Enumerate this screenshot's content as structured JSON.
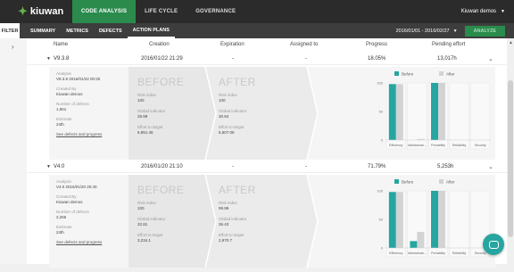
{
  "app": {
    "logo_text": "kiuwan",
    "user": "Kiuwan demos"
  },
  "topnav": [
    {
      "label": "CODE ANALYSIS",
      "active": true
    },
    {
      "label": "LIFE CYCLE",
      "active": false
    },
    {
      "label": "GOVERNANCE",
      "active": false
    }
  ],
  "subnav": {
    "filter_label": "FILTER",
    "tabs": [
      {
        "label": "SUMMARY"
      },
      {
        "label": "METRICS"
      },
      {
        "label": "DEFECTS"
      },
      {
        "label": "ACTION PLANS",
        "active": true
      }
    ],
    "date_range": "2016/01/01 - 2016/02/27",
    "analyze_label": "ANALYZE"
  },
  "table": {
    "columns": {
      "name": "Name",
      "creation": "Creation",
      "expiration": "Expiration",
      "assigned": "Assigned to",
      "progress": "Progress",
      "effort": "Pending effort"
    }
  },
  "plans": [
    {
      "name": "V9.3.8",
      "creation": "2016/01/22 21:29",
      "expiration": "-",
      "assigned": "-",
      "progress": "18.05%",
      "effort": "13,017h",
      "analysis_label": "Analysis",
      "analysis": "V9.3.8 2016/01/22 00:25",
      "created_by_label": "Created By",
      "created_by": "Kiuwan demos",
      "defects_label": "Number of defects",
      "defects": "1,801",
      "estimate_label": "Estimate",
      "estimate": "24th",
      "link": "See defects and progress",
      "before": {
        "title": "BEFORE",
        "risk_label": "Risk index",
        "risk": "100",
        "global_label": "Global indicator",
        "global": "29.98",
        "effort_label": "Effort to target",
        "effort": "6,851.45"
      },
      "after": {
        "title": "AFTER",
        "risk_label": "Risk index",
        "risk": "100",
        "global_label": "Global indicator",
        "global": "30.84",
        "effort_label": "Effort to target",
        "effort": "6,607.05"
      },
      "chart_data": {
        "type": "bar",
        "legend": [
          "Before",
          "After"
        ],
        "categories": [
          "Efficiency",
          "Maintainab...",
          "Portability",
          "Reliability",
          "Security"
        ],
        "series": [
          {
            "name": "Before",
            "values": [
              98,
              0,
              100,
              0,
              0
            ]
          },
          {
            "name": "After",
            "values": [
              98,
              2,
              100,
              0,
              0
            ]
          }
        ],
        "yticks": [
          "0",
          "50",
          "100"
        ],
        "ylim": [
          0,
          100
        ]
      }
    },
    {
      "name": "V4.0",
      "creation": "2016/01/20 21:10",
      "expiration": "-",
      "assigned": "-",
      "progress": "71.79%",
      "effort": "5,253h",
      "analysis_label": "Analysis",
      "analysis": "V4.0 2016/01/20 20:40",
      "created_by_label": "Created By",
      "created_by": "Kiuwan demos",
      "defects_label": "Number of defects",
      "defects": "2,265",
      "estimate_label": "Estimate",
      "estimate": "24th",
      "link": "See defects and progress",
      "before": {
        "title": "BEFORE",
        "risk_label": "Risk index",
        "risk": "100",
        "global_label": "Global indicator",
        "global": "32.81",
        "effort_label": "Effort to target",
        "effort": "3,234.1"
      },
      "after": {
        "title": "AFTER",
        "risk_label": "Risk index",
        "risk": "99.99",
        "global_label": "Global indicator",
        "global": "36.43",
        "effort_label": "Effort to target",
        "effort": "2,970.7"
      },
      "chart_data": {
        "type": "bar",
        "legend": [
          "Before",
          "After"
        ],
        "categories": [
          "Efficiency",
          "Maintainab...",
          "Portability",
          "Reliability",
          "Security"
        ],
        "series": [
          {
            "name": "Before",
            "values": [
              98,
              12,
              100,
              0,
              0
            ]
          },
          {
            "name": "After",
            "values": [
              98,
              28,
              100,
              0,
              0
            ]
          }
        ],
        "yticks": [
          "0",
          "50",
          "100"
        ],
        "ylim": [
          0,
          100
        ]
      }
    }
  ],
  "colors": {
    "before": "#27a5a0",
    "after": "#d3d3d3",
    "accent": "#2a8b4c"
  }
}
